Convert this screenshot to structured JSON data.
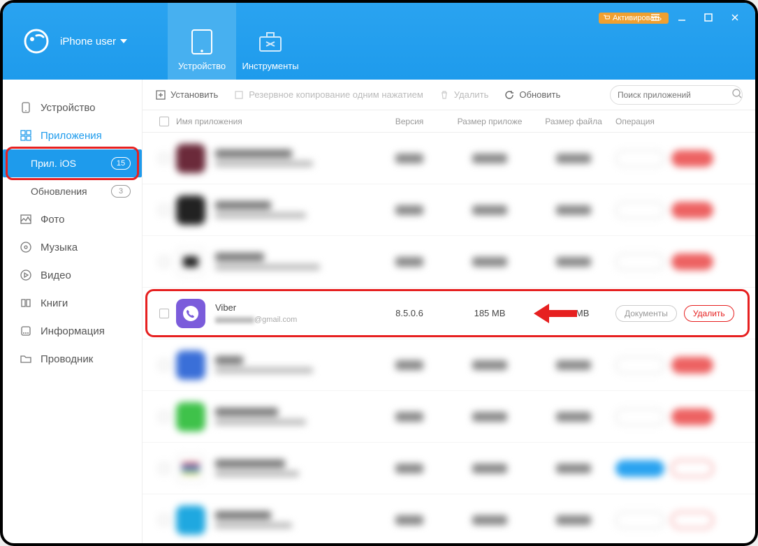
{
  "header": {
    "user_label": "iPhone user",
    "tab_device": "Устройство",
    "tab_tools": "Инструменты",
    "activate": "Активировать"
  },
  "sidebar": {
    "device": "Устройство",
    "apps": "Приложения",
    "ios_apps": "Прил. iOS",
    "ios_badge": "15",
    "updates": "Обновления",
    "updates_badge": "3",
    "photo": "Фото",
    "music": "Музыка",
    "video": "Видео",
    "books": "Книги",
    "info": "Информация",
    "explorer": "Проводник"
  },
  "toolbar": {
    "install": "Установить",
    "backup": "Резервное копирование одним нажатием",
    "delete": "Удалить",
    "refresh": "Обновить",
    "search_placeholder": "Поиск приложений"
  },
  "columns": {
    "name": "Имя приложения",
    "version": "Версия",
    "app_size": "Размер приложе",
    "file_size": "Размер файла",
    "ops": "Операция"
  },
  "viber": {
    "name": "Viber",
    "email_suffix": "@gmail.com",
    "version": "8.5.0.6",
    "app_size": "185 MB",
    "file_size": "306 MB",
    "docs": "Документы",
    "delete": "Удалить"
  }
}
